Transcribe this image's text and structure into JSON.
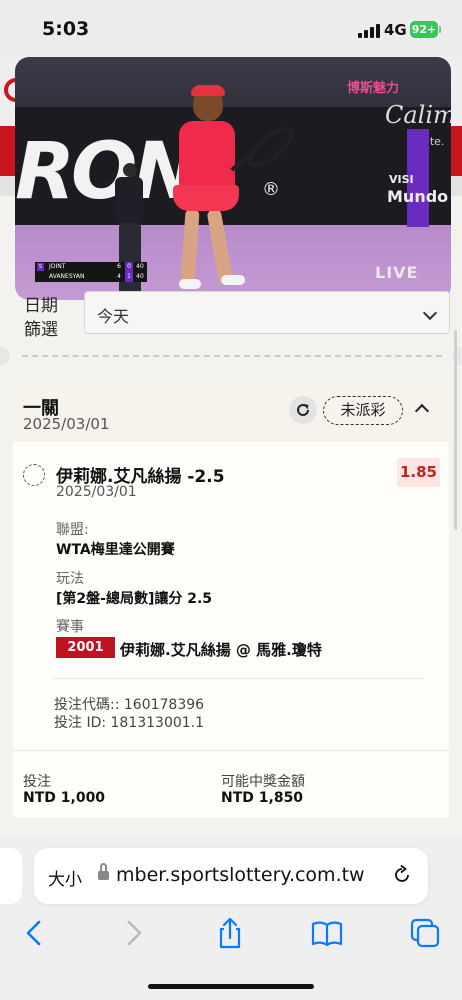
{
  "status_bar": {
    "time": "5:03",
    "network": "4G",
    "battery": "92+"
  },
  "video": {
    "brand_text": "RON",
    "reg_mark": "®",
    "sponsor_1": "博斯魅力",
    "sponsor_2": "Calim",
    "sponsor_3": "ciente.",
    "side_visa": "VISI",
    "side_mundo": "Mundo",
    "live_label": "LIVE",
    "scoreboard": [
      {
        "player": "JOINT",
        "set1": "6",
        "set2": "0",
        "points": "40"
      },
      {
        "player": "AVANESYAN",
        "set1": "4",
        "set2": "1",
        "points": "40"
      }
    ]
  },
  "filter": {
    "label": "日期\n篩選",
    "value": "今天"
  },
  "bet": {
    "type_title": "一關",
    "placed_date": "2025/03/01",
    "status": "未派彩",
    "selection": "伊莉娜.艾凡絲揚 -2.5",
    "selection_date": "2025/03/01",
    "odds": "1.85",
    "league_label": "聯盟:",
    "league_value": "WTA梅里達公開賽",
    "market_label": "玩法",
    "market_value": "[第2盤-總局數]讓分 2.5",
    "event_label": "賽事",
    "event_no": "2001",
    "event_match": "伊莉娜.艾凡絲揚 @ 馬雅.瓊特",
    "bet_code": "投注代碼:: 160178396",
    "bet_id": "投注 ID: 181313001.1",
    "stake_label": "投注",
    "stake_value": "NTD 1,000",
    "payout_label": "可能中獎金額",
    "payout_value": "NTD 1,850"
  },
  "browser": {
    "text_size_label": "大小",
    "url": "mber.sportslottery.com.tw",
    "toolbar_icons": [
      "back-icon",
      "forward-icon",
      "share-icon",
      "bookmarks-icon",
      "tabs-icon"
    ]
  },
  "colors": {
    "brand_red": "#c9151e",
    "odds_red": "#c81f1f",
    "event_badge": "#bd1421",
    "ios_blue": "#0a7aff",
    "battery_green": "#34c759"
  }
}
